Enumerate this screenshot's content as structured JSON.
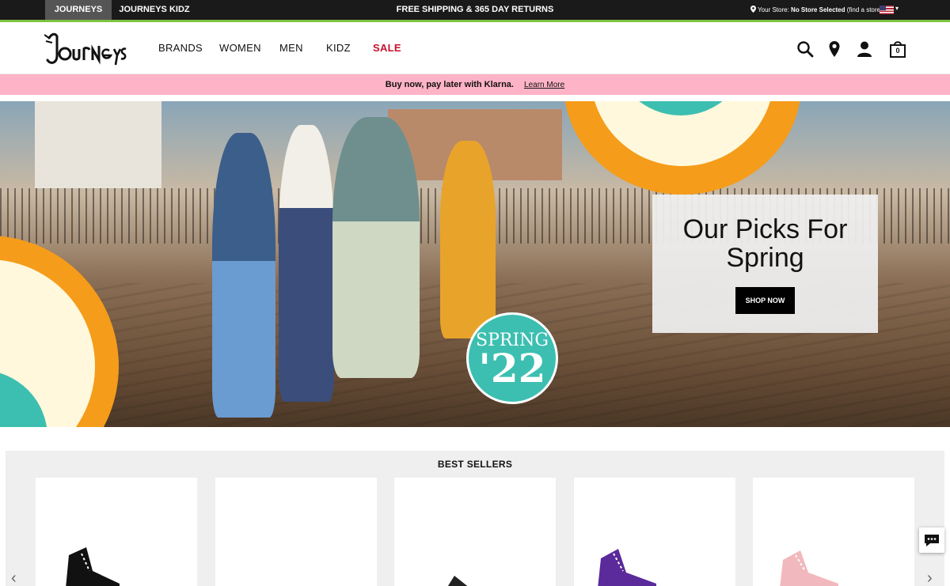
{
  "topbar": {
    "tabs": [
      "JOURNEYS",
      "JOURNEYS KIDZ"
    ],
    "promo": "FREE SHIPPING & 365 DAY RETURNS",
    "store_label": "Your Store:",
    "store_value": "No Store Selected",
    "store_link": "(find a store)"
  },
  "header": {
    "nav": [
      "BRANDS",
      "WOMEN",
      "MEN",
      "KIDZ",
      "SALE"
    ],
    "cart_count": "0",
    "icons": [
      "search-icon",
      "location-pin-icon",
      "account-icon",
      "shopping-bag-icon"
    ]
  },
  "klarna": {
    "message": "Buy now, pay later with Klarna.",
    "link": "Learn More"
  },
  "hero": {
    "badge_line1": "SPRING",
    "badge_line2": "'22",
    "headline": "Our Picks For Spring",
    "cta": "SHOP NOW"
  },
  "best_sellers": {
    "title": "BEST SELLERS",
    "products": [
      {
        "color": "#111111"
      },
      {
        "color": "#ffffff"
      },
      {
        "color": "#222222"
      },
      {
        "color": "#5b2a9b"
      },
      {
        "color": "#f1b9bd"
      }
    ]
  },
  "colors": {
    "accent_green": "#7cc242",
    "sale_red": "#c8102e",
    "klarna_pink": "#ffb3c7",
    "orange": "#f59c1a",
    "teal": "#3cbfb0",
    "cream": "#fff8dc"
  }
}
